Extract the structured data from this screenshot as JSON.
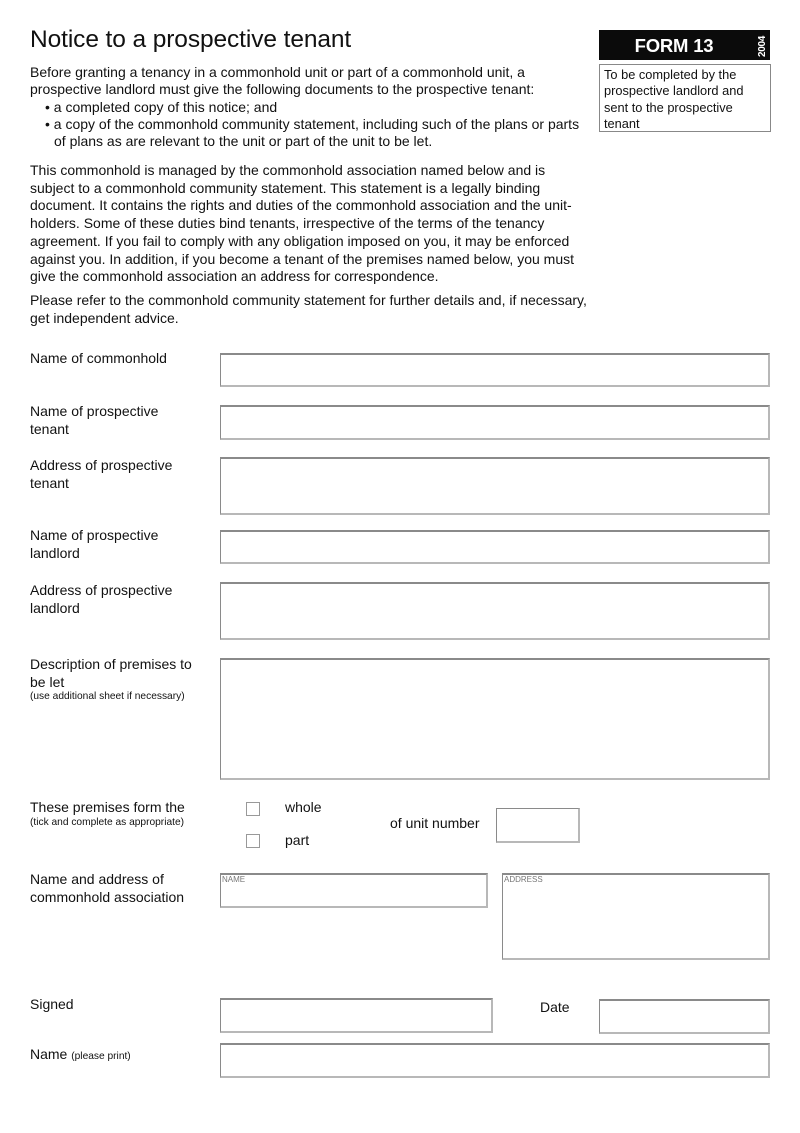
{
  "header": {
    "title": "Notice to a prospective tenant",
    "form_label": "FORM 13",
    "form_year": "2004",
    "note": "To be completed by the prospective landlord and sent to the prospective tenant"
  },
  "intro": {
    "lead": "Before granting a tenancy in a commonhold unit or part of a commonhold unit, a prospective landlord must give the following documents to the prospective tenant:",
    "bullets": [
      "a completed copy of this notice; and",
      "a copy of the commonhold community statement, including such of the plans or parts of plans as are relevant to the unit or part of the unit to be let."
    ],
    "paragraph2": "This commonhold is managed by the commonhold association named below and is subject to a commonhold community statement. This statement is a legally binding document. It contains the rights and duties of the commonhold association and the unit-holders. Some of these duties bind tenants, irrespective of the terms of the tenancy agreement. If you fail to comply with any obligation imposed on you, it may be enforced against you. In addition, if you become a tenant of the premises named below, you must give the commonhold association an address for correspondence.",
    "paragraph3": "Please refer to the commonhold community statement for further details and, if necessary, get independent advice."
  },
  "fields": {
    "commonhold_name": {
      "label": "Name of commonhold",
      "value": ""
    },
    "tenant_name": {
      "label": "Name of prospective tenant",
      "value": ""
    },
    "tenant_address": {
      "label": "Address of prospective tenant",
      "value": ""
    },
    "landlord_name": {
      "label": "Name of prospective landlord",
      "value": ""
    },
    "landlord_address": {
      "label": "Address of prospective landlord",
      "value": ""
    },
    "premises_description": {
      "label": "Description of premises to be let",
      "hint": "(use additional sheet if necessary)",
      "value": ""
    },
    "premises_form": {
      "label": "These premises form the",
      "hint": "(tick and complete as appropriate)",
      "option_whole": "whole",
      "option_part": "part",
      "whole_checked": false,
      "part_checked": false,
      "unit_label": "of unit number",
      "unit_value": ""
    },
    "association": {
      "label": "Name and address of commonhold association",
      "name_placeholder": "NAME",
      "address_placeholder": "ADDRESS",
      "name_value": "",
      "address_value": ""
    },
    "signed": {
      "label": "Signed",
      "value": ""
    },
    "date": {
      "label": "Date",
      "value": ""
    },
    "print_name": {
      "label": "Name",
      "hint": "(please print)",
      "value": ""
    }
  }
}
